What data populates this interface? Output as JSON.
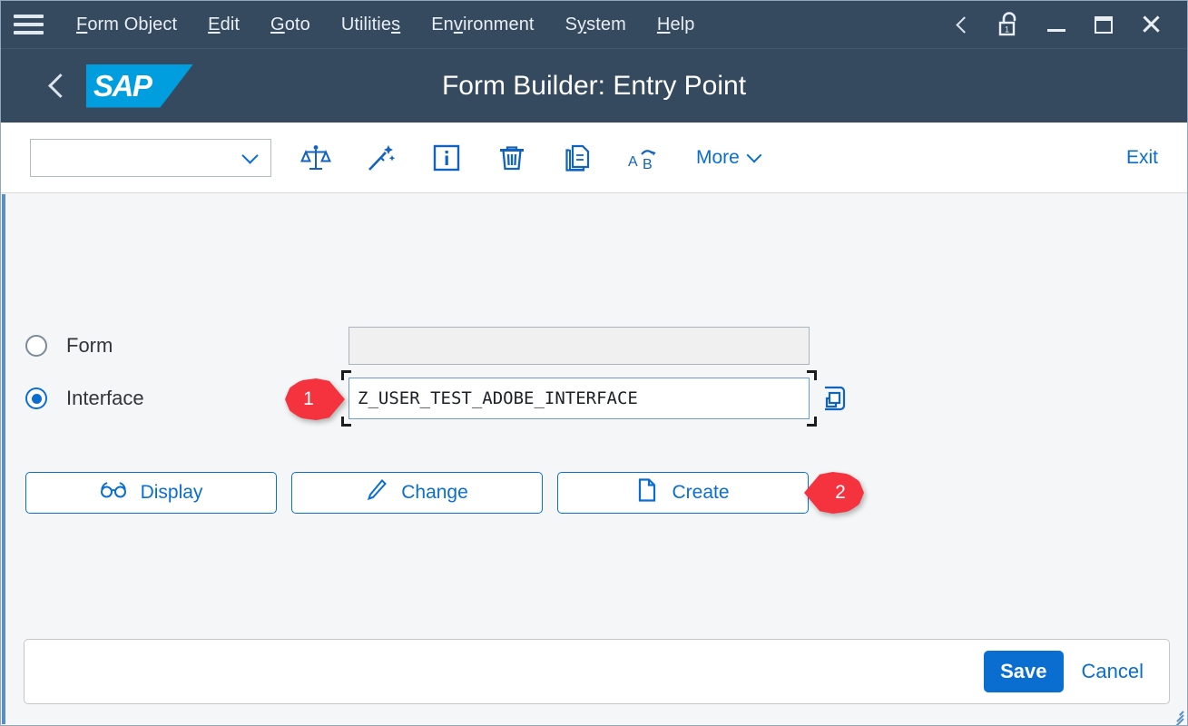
{
  "menubar": {
    "hamburger_icon": "hamburger-menu-icon",
    "items": [
      {
        "label": "Form Object",
        "accel_index": 0
      },
      {
        "label": "Edit",
        "accel_index": 0
      },
      {
        "label": "Goto",
        "accel_index": 0
      },
      {
        "label": "Utilities",
        "accel_index": 8
      },
      {
        "label": "Environment",
        "accel_index": 2
      },
      {
        "label": "System",
        "accel_index": 1
      },
      {
        "label": "Help",
        "accel_index": 0
      }
    ],
    "window_controls": [
      {
        "name": "back-chevron-icon",
        "label": ""
      },
      {
        "name": "lock-icon",
        "label": ""
      },
      {
        "name": "minimize-icon",
        "label": ""
      },
      {
        "name": "maximize-icon",
        "label": ""
      },
      {
        "name": "close-icon",
        "label": ""
      }
    ]
  },
  "titlebar": {
    "back_icon": "back-chevron-icon",
    "logo_text": "SAP",
    "title": "Form Builder: Entry Point"
  },
  "toolbar": {
    "select_value": "",
    "select_placeholder": "",
    "icons": [
      {
        "name": "compare-scale-icon",
        "tooltip": "Compare"
      },
      {
        "name": "magic-wand-icon",
        "tooltip": "Generate"
      },
      {
        "name": "info-icon",
        "tooltip": "Information"
      },
      {
        "name": "delete-trash-icon",
        "tooltip": "Delete"
      },
      {
        "name": "copy-icon",
        "tooltip": "Copy"
      },
      {
        "name": "rename-ab-icon",
        "tooltip": "Rename"
      }
    ],
    "more_label": "More",
    "exit_label": "Exit"
  },
  "main": {
    "options": [
      {
        "label": "Form",
        "selected": false,
        "field_value": "",
        "field_enabled": false
      },
      {
        "label": "Interface",
        "selected": true,
        "field_value": "Z_USER_TEST_ADOBE_INTERFACE",
        "field_enabled": true
      }
    ],
    "value_help_icon": "value-help-icon",
    "buttons": [
      {
        "label": "Display",
        "icon": "glasses-icon"
      },
      {
        "label": "Change",
        "icon": "pencil-icon"
      },
      {
        "label": "Create",
        "icon": "document-page-icon"
      }
    ],
    "markers": [
      {
        "number": "1",
        "direction": "right",
        "target": "interface-name-input"
      },
      {
        "number": "2",
        "direction": "left",
        "target": "create-button"
      }
    ]
  },
  "footer": {
    "save_label": "Save",
    "cancel_label": "Cancel",
    "resize_icon": "resize-grip-icon"
  },
  "colors": {
    "header_bg": "#354a5f",
    "sap_blue": "#009ede",
    "accent": "#0a6ed1",
    "marker_red": "#f5333f",
    "content_bg": "#f5f6f7"
  }
}
